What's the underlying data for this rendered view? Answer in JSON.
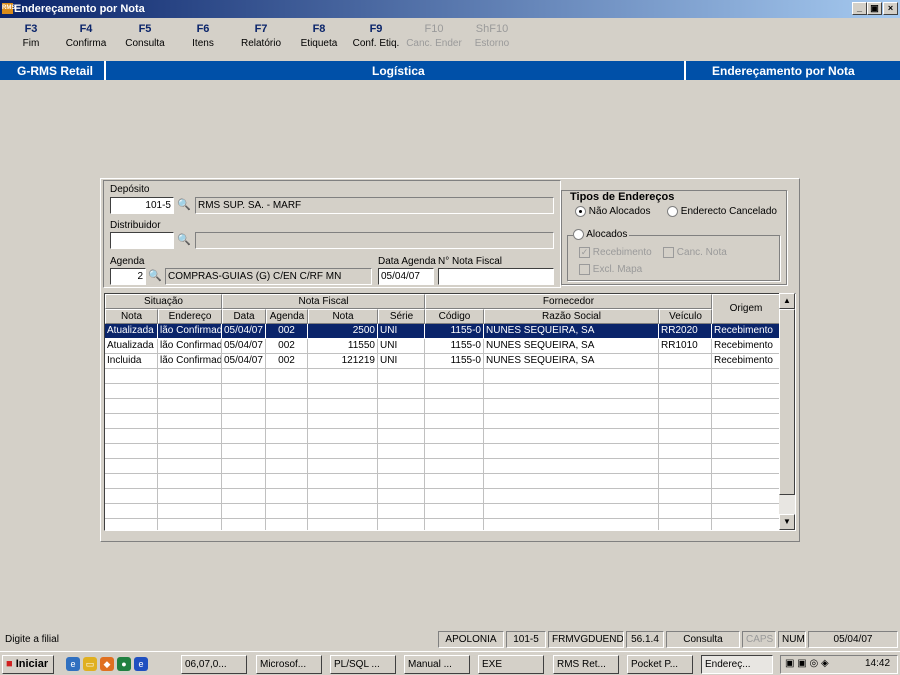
{
  "window": {
    "title": "Endereçamento por Nota",
    "app_icon_text": "RMS",
    "min": "_",
    "max": "▣",
    "close": "×"
  },
  "fkeys": [
    {
      "key": "F3",
      "label": "Fim"
    },
    {
      "key": "F4",
      "label": "Confirma"
    },
    {
      "key": "F5",
      "label": "Consulta"
    },
    {
      "key": "F6",
      "label": "Itens"
    },
    {
      "key": "F7",
      "label": "Relatório"
    },
    {
      "key": "F8",
      "label": "Etiqueta"
    },
    {
      "key": "F9",
      "label": "Conf. Etiq."
    },
    {
      "key": "F10",
      "label": "Canc. Ender"
    },
    {
      "key": "ShF10",
      "label": "Estorno"
    }
  ],
  "header_bar": {
    "left": "G-RMS Retail",
    "center": "Logística",
    "right": "Endereçamento por Nota"
  },
  "form": {
    "deposito_label": "Depósito",
    "deposito_code": "101-5",
    "deposito_name": "RMS SUP. SA. - MARF",
    "distribuidor_label": "Distribuidor",
    "distribuidor_code": "",
    "distribuidor_name": "",
    "agenda_label": "Agenda",
    "agenda_code": "2",
    "agenda_name": "COMPRAS-GUIAS (G) C/EN C/RF MN",
    "data_agenda_label": "Data Agenda",
    "data_agenda_value": "05/04/07",
    "nota_fiscal_label": "N° Nota Fiscal",
    "nota_fiscal_value": "",
    "binoculars": "🔍"
  },
  "tipos": {
    "title": "Tipos de Endereços",
    "nao_alocados": "Não Alocados",
    "endereco_cancelado": "Enderecto Cancelado",
    "alocados": "Alocados",
    "recebimento": "Recebimento",
    "canc_nota": "Canc. Nota",
    "excl_mapa": "Excl. Mapa",
    "check_mark": "✓"
  },
  "grid": {
    "group_headers": {
      "situacao": "Situação",
      "nota_fiscal": "Nota Fiscal",
      "fornecedor": "Fornecedor",
      "origem": "Origem"
    },
    "columns": {
      "nota": "Nota",
      "endereco": "Endereço",
      "data": "Data",
      "agenda": "Agenda",
      "nota_num": "Nota",
      "serie": "Série",
      "codigo": "Código",
      "razao_social": "Razão Social",
      "veiculo": "Veículo"
    },
    "rows": [
      {
        "nota": "Atualizada",
        "endereco": "lão Confirmad",
        "data": "05/04/07",
        "agenda": "002",
        "nota_num": "2500",
        "serie": "UNI",
        "codigo": "1155-0",
        "razao": "NUNES SEQUEIRA, SA",
        "veiculo": "RR2020",
        "origem": "Recebimento"
      },
      {
        "nota": "Atualizada",
        "endereco": "lão Confirmad",
        "data": "05/04/07",
        "agenda": "002",
        "nota_num": "11550",
        "serie": "UNI",
        "codigo": "1155-0",
        "razao": "NUNES SEQUEIRA, SA",
        "veiculo": "RR1010",
        "origem": "Recebimento"
      },
      {
        "nota": "Incluida",
        "endereco": "lão Confirmad",
        "data": "05/04/07",
        "agenda": "002",
        "nota_num": "121219",
        "serie": "UNI",
        "codigo": "1155-0",
        "razao": "NUNES SEQUEIRA, SA",
        "veiculo": "",
        "origem": "Recebimento"
      }
    ],
    "scroll_up": "▲",
    "scroll_down": "▼"
  },
  "statusbar": {
    "message": "Digite a filial",
    "server": "APOLONIA",
    "filial": "101-5",
    "form": "FRMVGDUENDE",
    "version": "56.1.4",
    "mode": "Consulta",
    "caps": "CAPS",
    "num": "NUM",
    "date": "05/04/07"
  },
  "taskbar": {
    "start": "Iniciar",
    "buttons": [
      "06,07,0...",
      "Microsof...",
      "PL/SQL ...",
      "Manual ...",
      "EXE",
      "RMS Ret...",
      "Pocket P...",
      "Endereç..."
    ],
    "clock": "14:42"
  }
}
